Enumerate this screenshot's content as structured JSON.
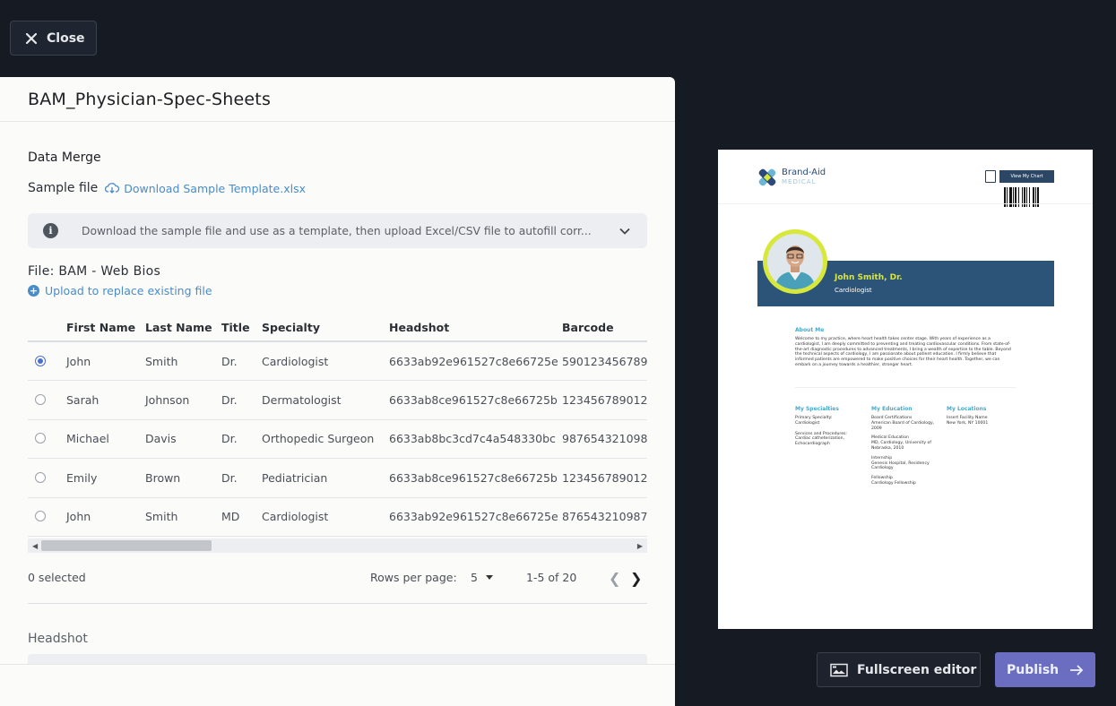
{
  "top": {
    "close_label": "Close"
  },
  "panel": {
    "title": "BAM_Physician-Spec-Sheets",
    "section_title": "Data Merge",
    "sample_label": "Sample file",
    "sample_link": "Download Sample Template.xlsx",
    "info_text": "Download the sample file and use as a template, then upload Excel/CSV file to autofill corr...",
    "file_label": "File: BAM - Web Bios",
    "upload_link": "Upload to replace existing file",
    "table": {
      "columns": [
        "First Name",
        "Last Name",
        "Title",
        "Specialty",
        "Headshot",
        "Barcode"
      ],
      "rows": [
        {
          "selected": true,
          "cells": [
            "John",
            "Smith",
            "Dr.",
            "Cardiologist",
            "6633ab92e961527c8e66725e",
            "590123456789"
          ]
        },
        {
          "selected": false,
          "cells": [
            "Sarah",
            "Johnson",
            "Dr.",
            "Dermatologist",
            "6633ab8ce961527c8e66725b",
            "123456789012"
          ]
        },
        {
          "selected": false,
          "cells": [
            "Michael",
            "Davis",
            "Dr.",
            "Orthopedic Surgeon",
            "6633ab8bc3cd7c4a548330bc",
            "987654321098"
          ]
        },
        {
          "selected": false,
          "cells": [
            "Emily",
            "Brown",
            "Dr.",
            "Pediatrician",
            "6633ab8ce961527c8e66725b",
            "123456789012"
          ]
        },
        {
          "selected": false,
          "cells": [
            "John",
            "Smith",
            "MD",
            "Cardiologist",
            "6633ab92e961527c8e66725e",
            "876543210987"
          ]
        }
      ]
    },
    "pager": {
      "selected_text": "0 selected",
      "rows_per_page_label": "Rows per page:",
      "rows_per_page_value": "5",
      "range_text": "1-5 of 20"
    },
    "headshot_label": "Headshot"
  },
  "preview": {
    "brand_name": "Brand-Aid",
    "brand_sub": "MEDICAL",
    "chart_button": "View My Chart",
    "doctor_name": "John Smith, Dr.",
    "doctor_role": "Cardiologist",
    "about_heading": "About Me",
    "about_text": "Welcome to my practice, where heart health takes center stage. With years of experience as a cardiologist, I am deeply committed to preventing and treating cardiovascular conditions. From state-of-the-art diagnostic procedures to advanced treatments, I bring a wealth of expertise to the table. Beyond the technical aspects of cardiology, I am passionate about patient education. I firmly believe that informed patients are empowered to make positive choices for their heart health. Together, we can embark on a journey towards a healthier, stronger heart.",
    "specialties_heading": "My Specialties",
    "specialties_primary_label": "Primary Specialty:",
    "specialties_primary_value": "Cardiologist",
    "specialties_services_label": "Services and Procedures:",
    "specialties_services_value": "Cardiac catheterization, Echocardiograph",
    "education_heading": "My Education",
    "education_board_label": "Board Certifications",
    "education_board_value": "American Board of Cardiology, 2009",
    "education_medical_label": "Medical Education",
    "education_medical_value": "MD, Cardiology, University of Nebraska, 2010",
    "education_internship_label": "Internship",
    "education_internship_value": "Genesis Hospital, Residency Cardiology",
    "education_fellowship_label": "Fellowship",
    "education_fellowship_value": "Cardiology Fellowship",
    "locations_heading": "My Locations",
    "locations_facility_label": "Insert Facility Name",
    "locations_facility_value": "New York, NY 10001"
  },
  "actions": {
    "fullscreen_label": "Fullscreen editor",
    "publish_label": "Publish"
  },
  "colors": {
    "page_bg": "#151a23",
    "link": "#4a8cc9",
    "publish": "#6b6ec0",
    "preview_banner": "#2c5478",
    "preview_accent": "#d8e83a"
  }
}
